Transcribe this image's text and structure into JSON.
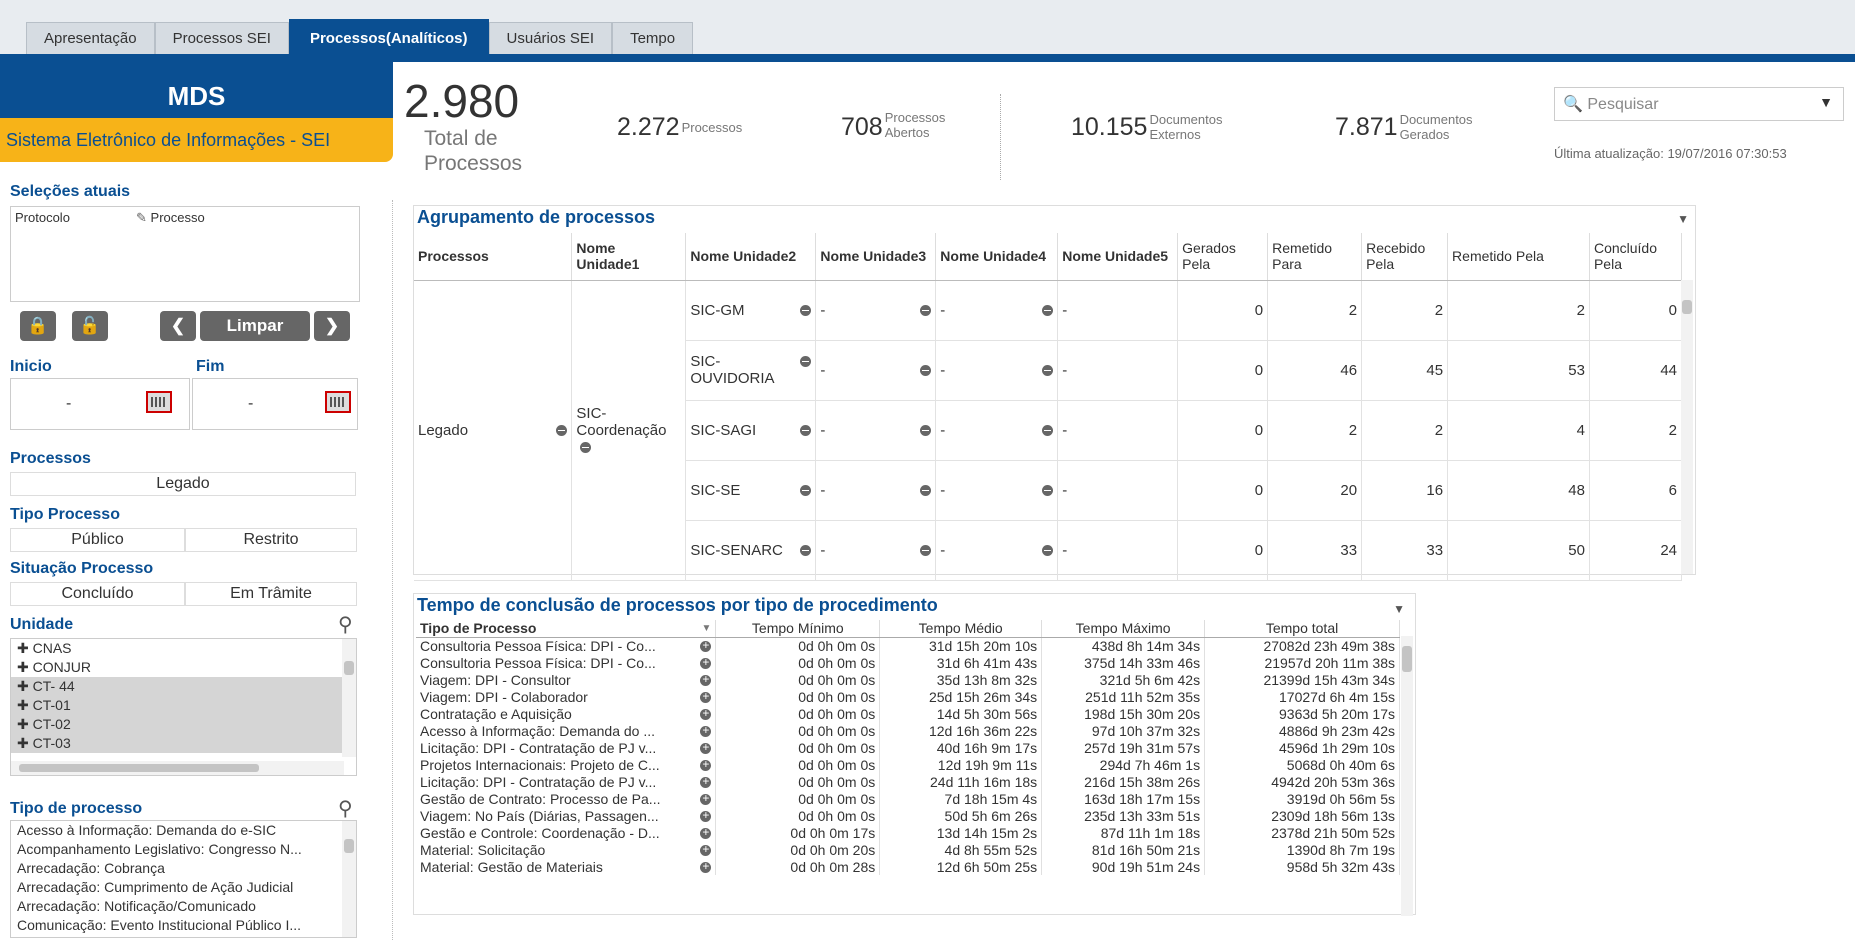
{
  "tabs": [
    "Apresentação",
    "Processos SEI",
    "Processos(Analíticos)",
    "Usuários SEI",
    "Tempo"
  ],
  "active_tab": "Processos(Analíticos)",
  "brand": {
    "title": "MDS",
    "subtitle": "Sistema Eletrônico de Informações - SEI"
  },
  "kpis": {
    "total_num": "2.980",
    "total_label": "Total de Processos",
    "processos_num": "2.272",
    "processos_label": "Processos",
    "abertos_num": "708",
    "abertos_label_1": "Processos",
    "abertos_label_2": "Abertos",
    "externos_num": "10.155",
    "externos_label_1": "Documentos",
    "externos_label_2": "Externos",
    "gerados_num": "7.871",
    "gerados_label_1": "Documentos",
    "gerados_label_2": "Gerados"
  },
  "search": {
    "placeholder": "Pesquisar",
    "last_update": "Última atualização: 19/07/2016 07:30:53"
  },
  "selections": {
    "title": "Seleções atuais",
    "field": "Protocolo",
    "value": "Processo"
  },
  "buttons": {
    "clear": "Limpar"
  },
  "dates": {
    "start_label": "Inicio",
    "end_label": "Fim",
    "start_value": "-",
    "end_value": "-"
  },
  "filters": {
    "processos_title": "Processos",
    "processos_value": "Legado",
    "tipo_title": "Tipo Processo",
    "tipo_values": [
      "Público",
      "Restrito"
    ],
    "situacao_title": "Situação Processo",
    "situacao_values": [
      "Concluído",
      "Em Trâmite"
    ]
  },
  "unidade": {
    "title": "Unidade",
    "items": [
      "CNAS",
      "CONJUR",
      "CT- 44",
      "CT-01",
      "CT-02",
      "CT-03"
    ]
  },
  "tipo_processo": {
    "title": "Tipo de processo",
    "items": [
      "Acesso à Informação: Demanda do e-SIC",
      "Acompanhamento Legislativo: Congresso N...",
      "Arrecadação: Cobrança",
      "Arrecadação: Cumprimento de Ação Judicial",
      "Arrecadação: Notificação/Comunicado",
      "Comunicação: Evento Institucional Público I..."
    ]
  },
  "agrupamento": {
    "title": "Agrupamento de processos",
    "headers": [
      "Processos",
      "Nome Unidade1",
      "Nome Unidade2",
      "Nome Unidade3",
      "Nome Unidade4",
      "Nome Unidade5",
      "Gerados Pela",
      "Remetido Para",
      "Recebido Pela",
      "Remetido Pela",
      "Concluído Pela"
    ],
    "processo": "Legado",
    "unidade1": "SIC-Coordenação",
    "rows": [
      {
        "u2": "SIC-GM",
        "u3": "-",
        "u4": "-",
        "u5": "-",
        "gerados": "0",
        "remetido_para": "2",
        "recebido": "2",
        "remetido_pela": "2",
        "concluido": "0"
      },
      {
        "u2": "SIC-OUVIDORIA",
        "u3": "-",
        "u4": "-",
        "u5": "-",
        "gerados": "0",
        "remetido_para": "46",
        "recebido": "45",
        "remetido_pela": "53",
        "concluido": "44"
      },
      {
        "u2": "SIC-SAGI",
        "u3": "-",
        "u4": "-",
        "u5": "-",
        "gerados": "0",
        "remetido_para": "2",
        "recebido": "2",
        "remetido_pela": "4",
        "concluido": "2"
      },
      {
        "u2": "SIC-SE",
        "u3": "-",
        "u4": "-",
        "u5": "-",
        "gerados": "0",
        "remetido_para": "20",
        "recebido": "16",
        "remetido_pela": "48",
        "concluido": "6"
      },
      {
        "u2": "SIC-SENARC",
        "u3": "-",
        "u4": "-",
        "u5": "-",
        "gerados": "0",
        "remetido_para": "33",
        "recebido": "33",
        "remetido_pela": "50",
        "concluido": "24"
      }
    ]
  },
  "tempo": {
    "title": "Tempo de conclusão de processos por tipo de procedimento",
    "headers": [
      "Tipo de Processo",
      "Tempo Mínimo",
      "Tempo Médio",
      "Tempo Máximo",
      "Tempo total"
    ],
    "rows": [
      [
        "Consultoria Pessoa Física: DPI - Co...",
        "0d 0h 0m 0s",
        "31d 15h 20m 10s",
        "438d 8h 14m 34s",
        "27082d 23h 49m 38s"
      ],
      [
        "Consultoria Pessoa Física: DPI - Co...",
        "0d 0h 0m 0s",
        "31d 6h 41m 43s",
        "375d 14h 33m 46s",
        "21957d 20h 11m 38s"
      ],
      [
        "Viagem: DPI - Consultor",
        "0d 0h 0m 0s",
        "35d 13h 8m 32s",
        "321d 5h 6m 42s",
        "21399d 15h 43m 34s"
      ],
      [
        "Viagem: DPI - Colaborador",
        "0d 0h 0m 0s",
        "25d 15h 26m 34s",
        "251d 11h 52m 35s",
        "17027d 6h 4m 15s"
      ],
      [
        "Contratação e Aquisição",
        "0d 0h 0m 0s",
        "14d 5h 30m 56s",
        "198d 15h 30m 20s",
        "9363d 5h 20m 17s"
      ],
      [
        "Acesso à Informação: Demanda do ...",
        "0d 0h 0m 0s",
        "12d 16h 36m 22s",
        "97d 10h 37m 32s",
        "4886d 9h 23m 42s"
      ],
      [
        "Licitação: DPI - Contratação de PJ v...",
        "0d 0h 0m 0s",
        "40d 16h 9m 17s",
        "257d 19h 31m 57s",
        "4596d 1h 29m 10s"
      ],
      [
        "Projetos Internacionais: Projeto de C...",
        "0d 0h 0m 0s",
        "12d 19h 9m 11s",
        "294d 7h 46m 1s",
        "5068d 0h 40m 6s"
      ],
      [
        "Licitação: DPI - Contratação de PJ v...",
        "0d 0h 0m 0s",
        "24d 11h 16m 18s",
        "216d 15h 38m 26s",
        "4942d 20h 53m 36s"
      ],
      [
        "Gestão de Contrato: Processo de Pa...",
        "0d 0h 0m 0s",
        "7d 18h 15m 4s",
        "163d 18h 17m 15s",
        "3919d 0h 56m 5s"
      ],
      [
        "Viagem: No País (Diárias, Passagen...",
        "0d 0h 0m 0s",
        "50d 5h 6m 26s",
        "235d 13h 33m 51s",
        "2309d 18h 56m 13s"
      ],
      [
        "Gestão e Controle: Coordenação - D...",
        "0d 0h 0m 17s",
        "13d 14h 15m 2s",
        "87d 11h 1m 18s",
        "2378d 21h 50m 52s"
      ],
      [
        "Material: Solicitação",
        "0d 0h 0m 20s",
        "4d 8h 55m 52s",
        "81d 16h 50m 21s",
        "1390d 8h 7m 19s"
      ],
      [
        "Material: Gestão de Materiais",
        "0d 0h 0m 28s",
        "12d 6h 50m 25s",
        "90d 19h 51m 24s",
        "958d 5h 32m 43s"
      ]
    ]
  },
  "colors": {
    "brand_blue": "#0a4f92",
    "brand_yellow": "#f7b318"
  }
}
